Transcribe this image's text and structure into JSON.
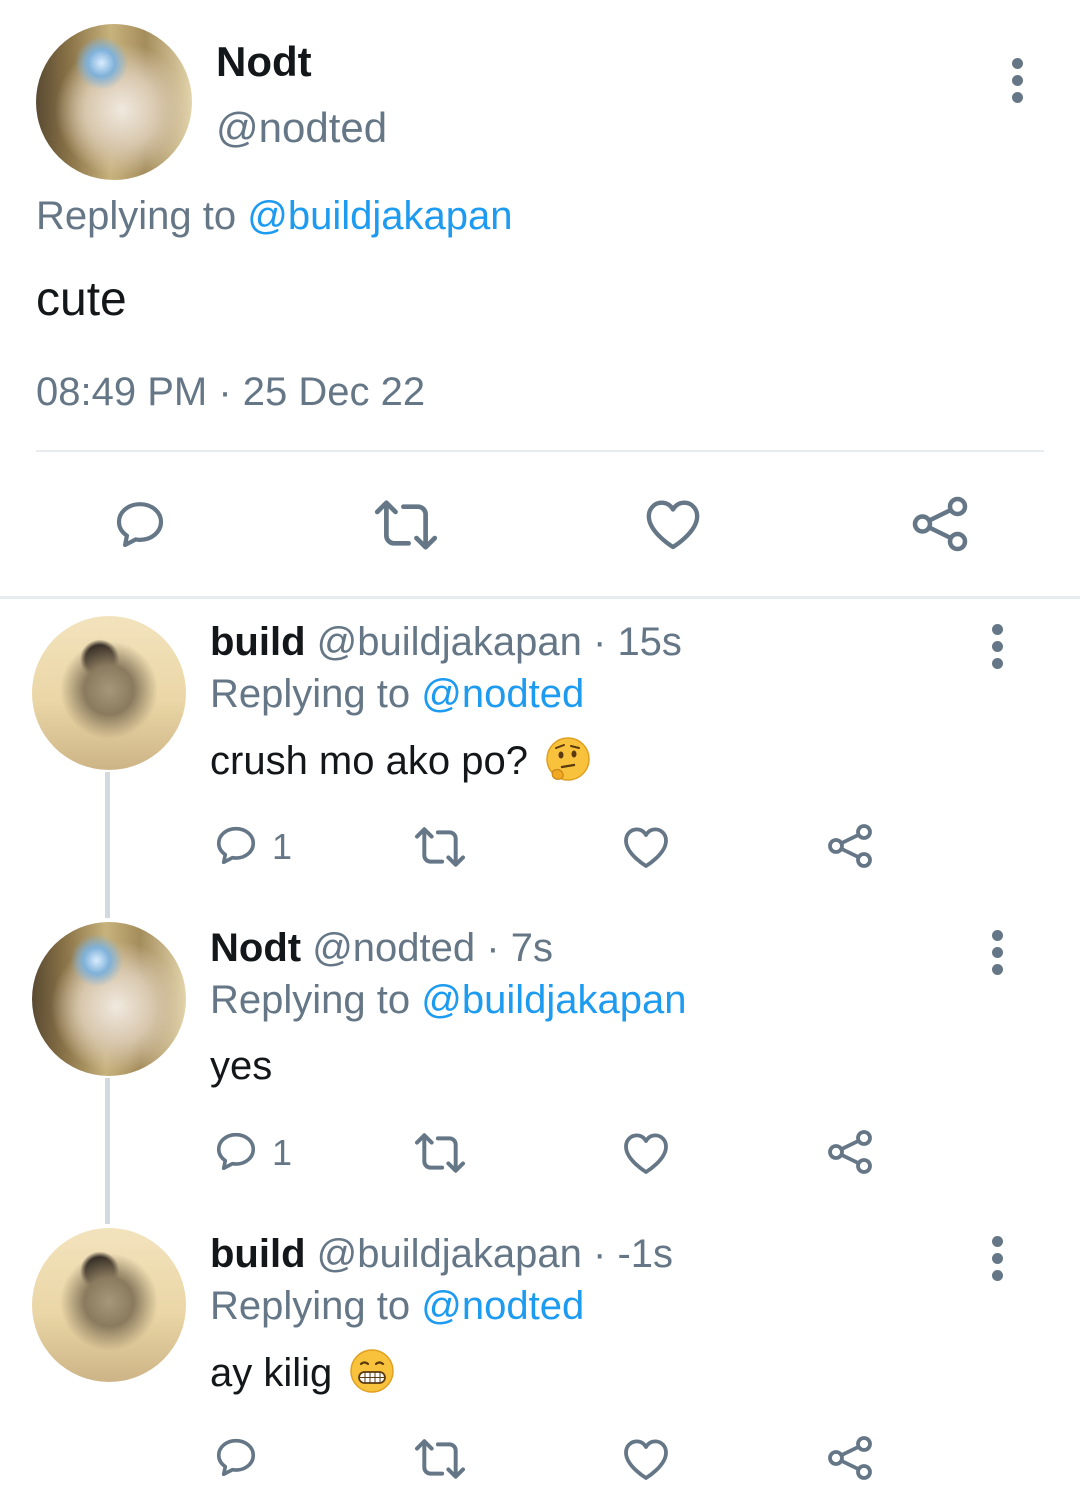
{
  "main_tweet": {
    "name": "Nodt",
    "handle": "@nodted",
    "replying_label": "Replying to",
    "replying_to": "@buildjakapan",
    "text": "cute",
    "timestamp": "08:49 PM · 25 Dec 22"
  },
  "replies": [
    {
      "name": "build",
      "meta": "@buildjakapan · 15s",
      "replying_label": "Replying to",
      "replying_to": "@nodted",
      "text": "crush mo ako po?",
      "emoji": "thinking-face",
      "reply_count": "1"
    },
    {
      "name": "Nodt",
      "meta": "@nodted · 7s",
      "replying_label": "Replying to",
      "replying_to": "@buildjakapan",
      "text": "yes",
      "reply_count": "1"
    },
    {
      "name": "build",
      "meta": "@buildjakapan · -1s",
      "replying_label": "Replying to",
      "replying_to": "@nodted",
      "text": "ay kilig",
      "emoji": "grinning-face",
      "reply_count": ""
    }
  ],
  "colors": {
    "link": "#1d9bf0",
    "muted": "#657786",
    "text": "#14171a",
    "divider": "#e6ecf0"
  },
  "icons": [
    "comment-icon",
    "retweet-icon",
    "like-icon",
    "share-icon",
    "more-icon"
  ]
}
